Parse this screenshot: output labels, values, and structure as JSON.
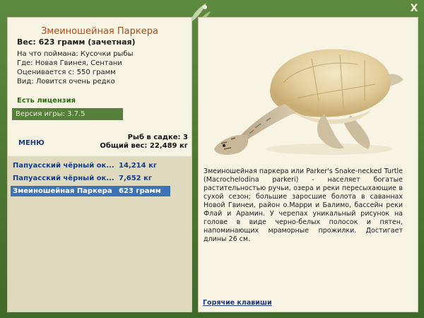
{
  "window": {
    "close_label": "X"
  },
  "fish": {
    "title": "Змеиношейная Паркера",
    "weight_line": "Вес: 623 грамм (зачетная)",
    "info": [
      "На что поймана: Кусочки рыбы",
      "Где: Новая Гвинея, Сентани",
      "Оценивается с: 550 грамм",
      "Вид: Ловится очень редко"
    ]
  },
  "license_label": "Есть лицензия",
  "version_label": "Версия игры: 3.7.5",
  "menu_label": "МЕНЮ",
  "cage": {
    "count_line": "Рыб в садке: 3",
    "total_line": "Общий вес: 22,489 кг"
  },
  "catch_list": [
    {
      "name": "Папуасский чёрный ок...",
      "weight": "14,214 кг",
      "selected": false
    },
    {
      "name": "Папуасский чёрный ок...",
      "weight": "7,652 кг",
      "selected": false
    },
    {
      "name": "Змеиношейная Паркера",
      "weight": "623 грамм",
      "selected": true
    }
  ],
  "description": "Змеиношейная паркера или Parker's Snake-necked Turtle (Macrochelodina parkeri) - населяет богатые растительностью ручьи, озера и реки пересыхающие в сухой сезон; большие заросшие болота в саваннах Новой Гвинеи, район о.Марри и Балимо, бассейн реки Флай и Арамин. У черепах уникальный рисунок на голове в виде черно-белых полосок и пятен, напоминающих мраморные прожилки. Достигает длины 26 см.",
  "hotkeys_label": "Горячие клавиши",
  "colors": {
    "frame": "#4a7531",
    "panel": "#f7f4e4",
    "title": "#b34a12",
    "link": "#1e3a78",
    "selection": "#3b73b6"
  }
}
